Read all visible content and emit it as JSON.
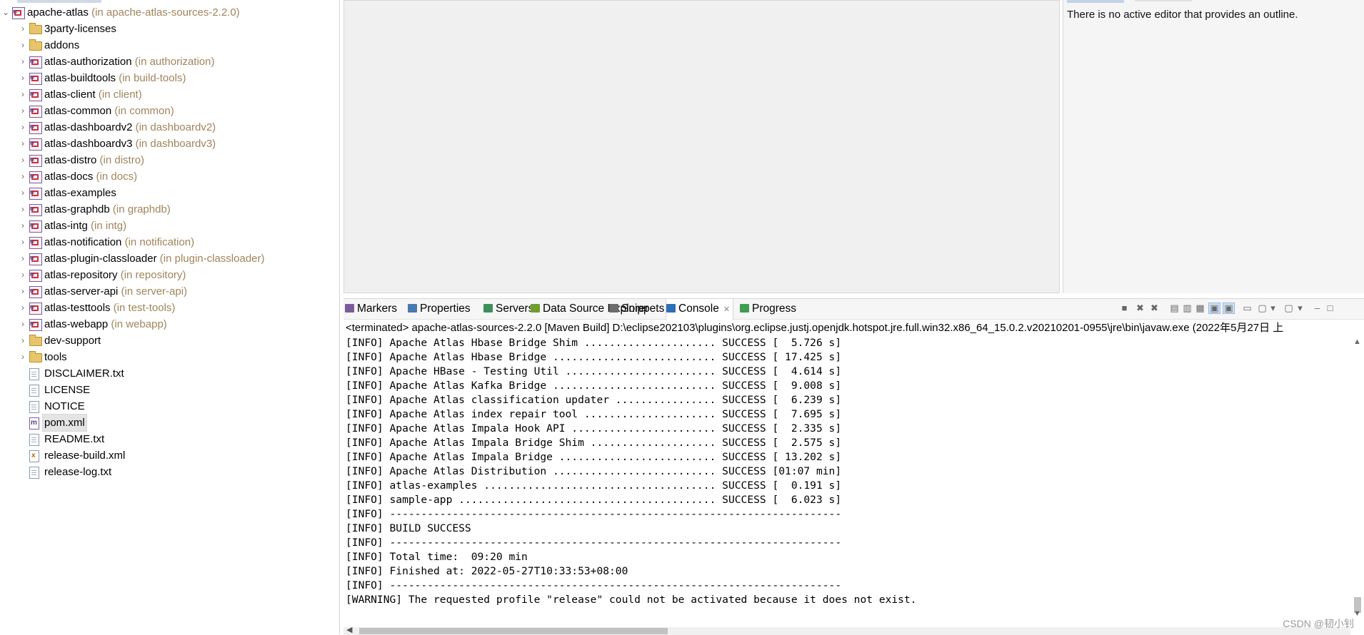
{
  "explorer": {
    "rows": [
      {
        "name": "apache-atlas",
        "decoration": " (in apache-atlas-sources-2.2.0)",
        "icon": "maven-project-icon",
        "expanded": true,
        "level": 0
      },
      {
        "name": "3party-licenses",
        "decoration": "",
        "icon": "folder-icon",
        "expanded": false,
        "level": 1
      },
      {
        "name": "addons",
        "decoration": "",
        "icon": "folder-icon",
        "expanded": false,
        "level": 1
      },
      {
        "name": "atlas-authorization",
        "decoration": " (in authorization)",
        "icon": "maven-project-icon",
        "expanded": false,
        "level": 1
      },
      {
        "name": "atlas-buildtools",
        "decoration": " (in build-tools)",
        "icon": "maven-project-icon",
        "expanded": false,
        "level": 1
      },
      {
        "name": "atlas-client",
        "decoration": " (in client)",
        "icon": "maven-project-icon",
        "expanded": false,
        "level": 1
      },
      {
        "name": "atlas-common",
        "decoration": " (in common)",
        "icon": "maven-project-icon",
        "expanded": false,
        "level": 1
      },
      {
        "name": "atlas-dashboardv2",
        "decoration": " (in dashboardv2)",
        "icon": "maven-project-icon",
        "expanded": false,
        "level": 1
      },
      {
        "name": "atlas-dashboardv3",
        "decoration": " (in dashboardv3)",
        "icon": "maven-project-icon",
        "expanded": false,
        "level": 1
      },
      {
        "name": "atlas-distro",
        "decoration": " (in distro)",
        "icon": "maven-project-icon",
        "expanded": false,
        "level": 1
      },
      {
        "name": "atlas-docs",
        "decoration": " (in docs)",
        "icon": "maven-project-icon",
        "expanded": false,
        "level": 1
      },
      {
        "name": "atlas-examples",
        "decoration": "",
        "icon": "maven-project-icon",
        "expanded": false,
        "level": 1
      },
      {
        "name": "atlas-graphdb",
        "decoration": " (in graphdb)",
        "icon": "maven-project-icon",
        "expanded": false,
        "level": 1
      },
      {
        "name": "atlas-intg",
        "decoration": " (in intg)",
        "icon": "maven-project-icon",
        "expanded": false,
        "level": 1
      },
      {
        "name": "atlas-notification",
        "decoration": " (in notification)",
        "icon": "maven-project-icon",
        "expanded": false,
        "level": 1
      },
      {
        "name": "atlas-plugin-classloader",
        "decoration": " (in plugin-classloader)",
        "icon": "maven-project-icon",
        "expanded": false,
        "level": 1
      },
      {
        "name": "atlas-repository",
        "decoration": " (in repository)",
        "icon": "maven-project-icon",
        "expanded": false,
        "level": 1
      },
      {
        "name": "atlas-server-api",
        "decoration": " (in server-api)",
        "icon": "maven-project-icon",
        "expanded": false,
        "level": 1
      },
      {
        "name": "atlas-testtools",
        "decoration": " (in test-tools)",
        "icon": "maven-project-icon",
        "expanded": false,
        "level": 1
      },
      {
        "name": "atlas-webapp",
        "decoration": " (in webapp)",
        "icon": "maven-project-icon",
        "expanded": false,
        "level": 1
      },
      {
        "name": "dev-support",
        "decoration": "",
        "icon": "folder-icon",
        "expanded": false,
        "level": 1
      },
      {
        "name": "tools",
        "decoration": "",
        "icon": "folder-icon",
        "expanded": false,
        "level": 1
      },
      {
        "name": "DISCLAIMER.txt",
        "decoration": "",
        "icon": "text-file-icon",
        "level": 1,
        "leaf": true
      },
      {
        "name": "LICENSE",
        "decoration": "",
        "icon": "text-file-icon",
        "level": 1,
        "leaf": true
      },
      {
        "name": "NOTICE",
        "decoration": "",
        "icon": "text-file-icon",
        "level": 1,
        "leaf": true
      },
      {
        "name": "pom.xml",
        "decoration": "",
        "icon": "maven-pom-icon",
        "level": 1,
        "leaf": true,
        "selected": true
      },
      {
        "name": "README.txt",
        "decoration": "",
        "icon": "text-file-icon",
        "level": 1,
        "leaf": true
      },
      {
        "name": "release-build.xml",
        "decoration": "",
        "icon": "xml-file-icon",
        "level": 1,
        "leaf": true
      },
      {
        "name": "release-log.txt",
        "decoration": "",
        "icon": "text-file-icon",
        "level": 1,
        "leaf": true
      }
    ]
  },
  "outline": {
    "message": "There is no active editor that provides an outline."
  },
  "bottom_tabs": [
    {
      "label": "Markers",
      "icon": "markers-icon",
      "color": "#7a5c9a"
    },
    {
      "label": "Properties",
      "icon": "properties-icon",
      "color": "#4a78b0"
    },
    {
      "label": "Servers",
      "icon": "servers-icon",
      "color": "#3f8f5a"
    },
    {
      "label": "Data Source Explorer",
      "icon": "data-source-icon",
      "color": "#6f9e2f"
    },
    {
      "label": "Snippets",
      "icon": "snippets-icon",
      "color": "#6b6b6b"
    },
    {
      "label": "Console",
      "icon": "console-icon",
      "color": "#2f6fb5",
      "active": true
    },
    {
      "label": "Progress",
      "icon": "progress-icon",
      "color": "#3f9f4f"
    }
  ],
  "console": {
    "terminated_line": "<terminated> apache-atlas-sources-2.2.0 [Maven Build] D:\\eclipse202103\\plugins\\org.eclipse.justj.openjdk.hotspot.jre.full.win32.x86_64_15.0.2.v20210201-0955\\jre\\bin\\javaw.exe  (2022年5月27日 上",
    "lines": [
      "[INFO] Apache Atlas Hbase Bridge Shim ..................... SUCCESS [  5.726 s]",
      "[INFO] Apache Atlas Hbase Bridge .......................... SUCCESS [ 17.425 s]",
      "[INFO] Apache HBase - Testing Util ........................ SUCCESS [  4.614 s]",
      "[INFO] Apache Atlas Kafka Bridge .......................... SUCCESS [  9.008 s]",
      "[INFO] Apache Atlas classification updater ................ SUCCESS [  6.239 s]",
      "[INFO] Apache Atlas index repair tool ..................... SUCCESS [  7.695 s]",
      "[INFO] Apache Atlas Impala Hook API ....................... SUCCESS [  2.335 s]",
      "[INFO] Apache Atlas Impala Bridge Shim .................... SUCCESS [  2.575 s]",
      "[INFO] Apache Atlas Impala Bridge ......................... SUCCESS [ 13.202 s]",
      "[INFO] Apache Atlas Distribution .......................... SUCCESS [01:07 min]",
      "[INFO] atlas-examples ..................................... SUCCESS [  0.191 s]",
      "[INFO] sample-app ......................................... SUCCESS [  6.023 s]",
      "[INFO] ------------------------------------------------------------------------",
      "[INFO] BUILD SUCCESS",
      "[INFO] ------------------------------------------------------------------------",
      "[INFO] Total time:  09:20 min",
      "[INFO] Finished at: 2022-05-27T10:33:53+08:00",
      "[INFO] ------------------------------------------------------------------------",
      "[WARNING] The requested profile \"release\" could not be activated because it does not exist."
    ]
  },
  "watermark": "CSDN @韧小钊"
}
